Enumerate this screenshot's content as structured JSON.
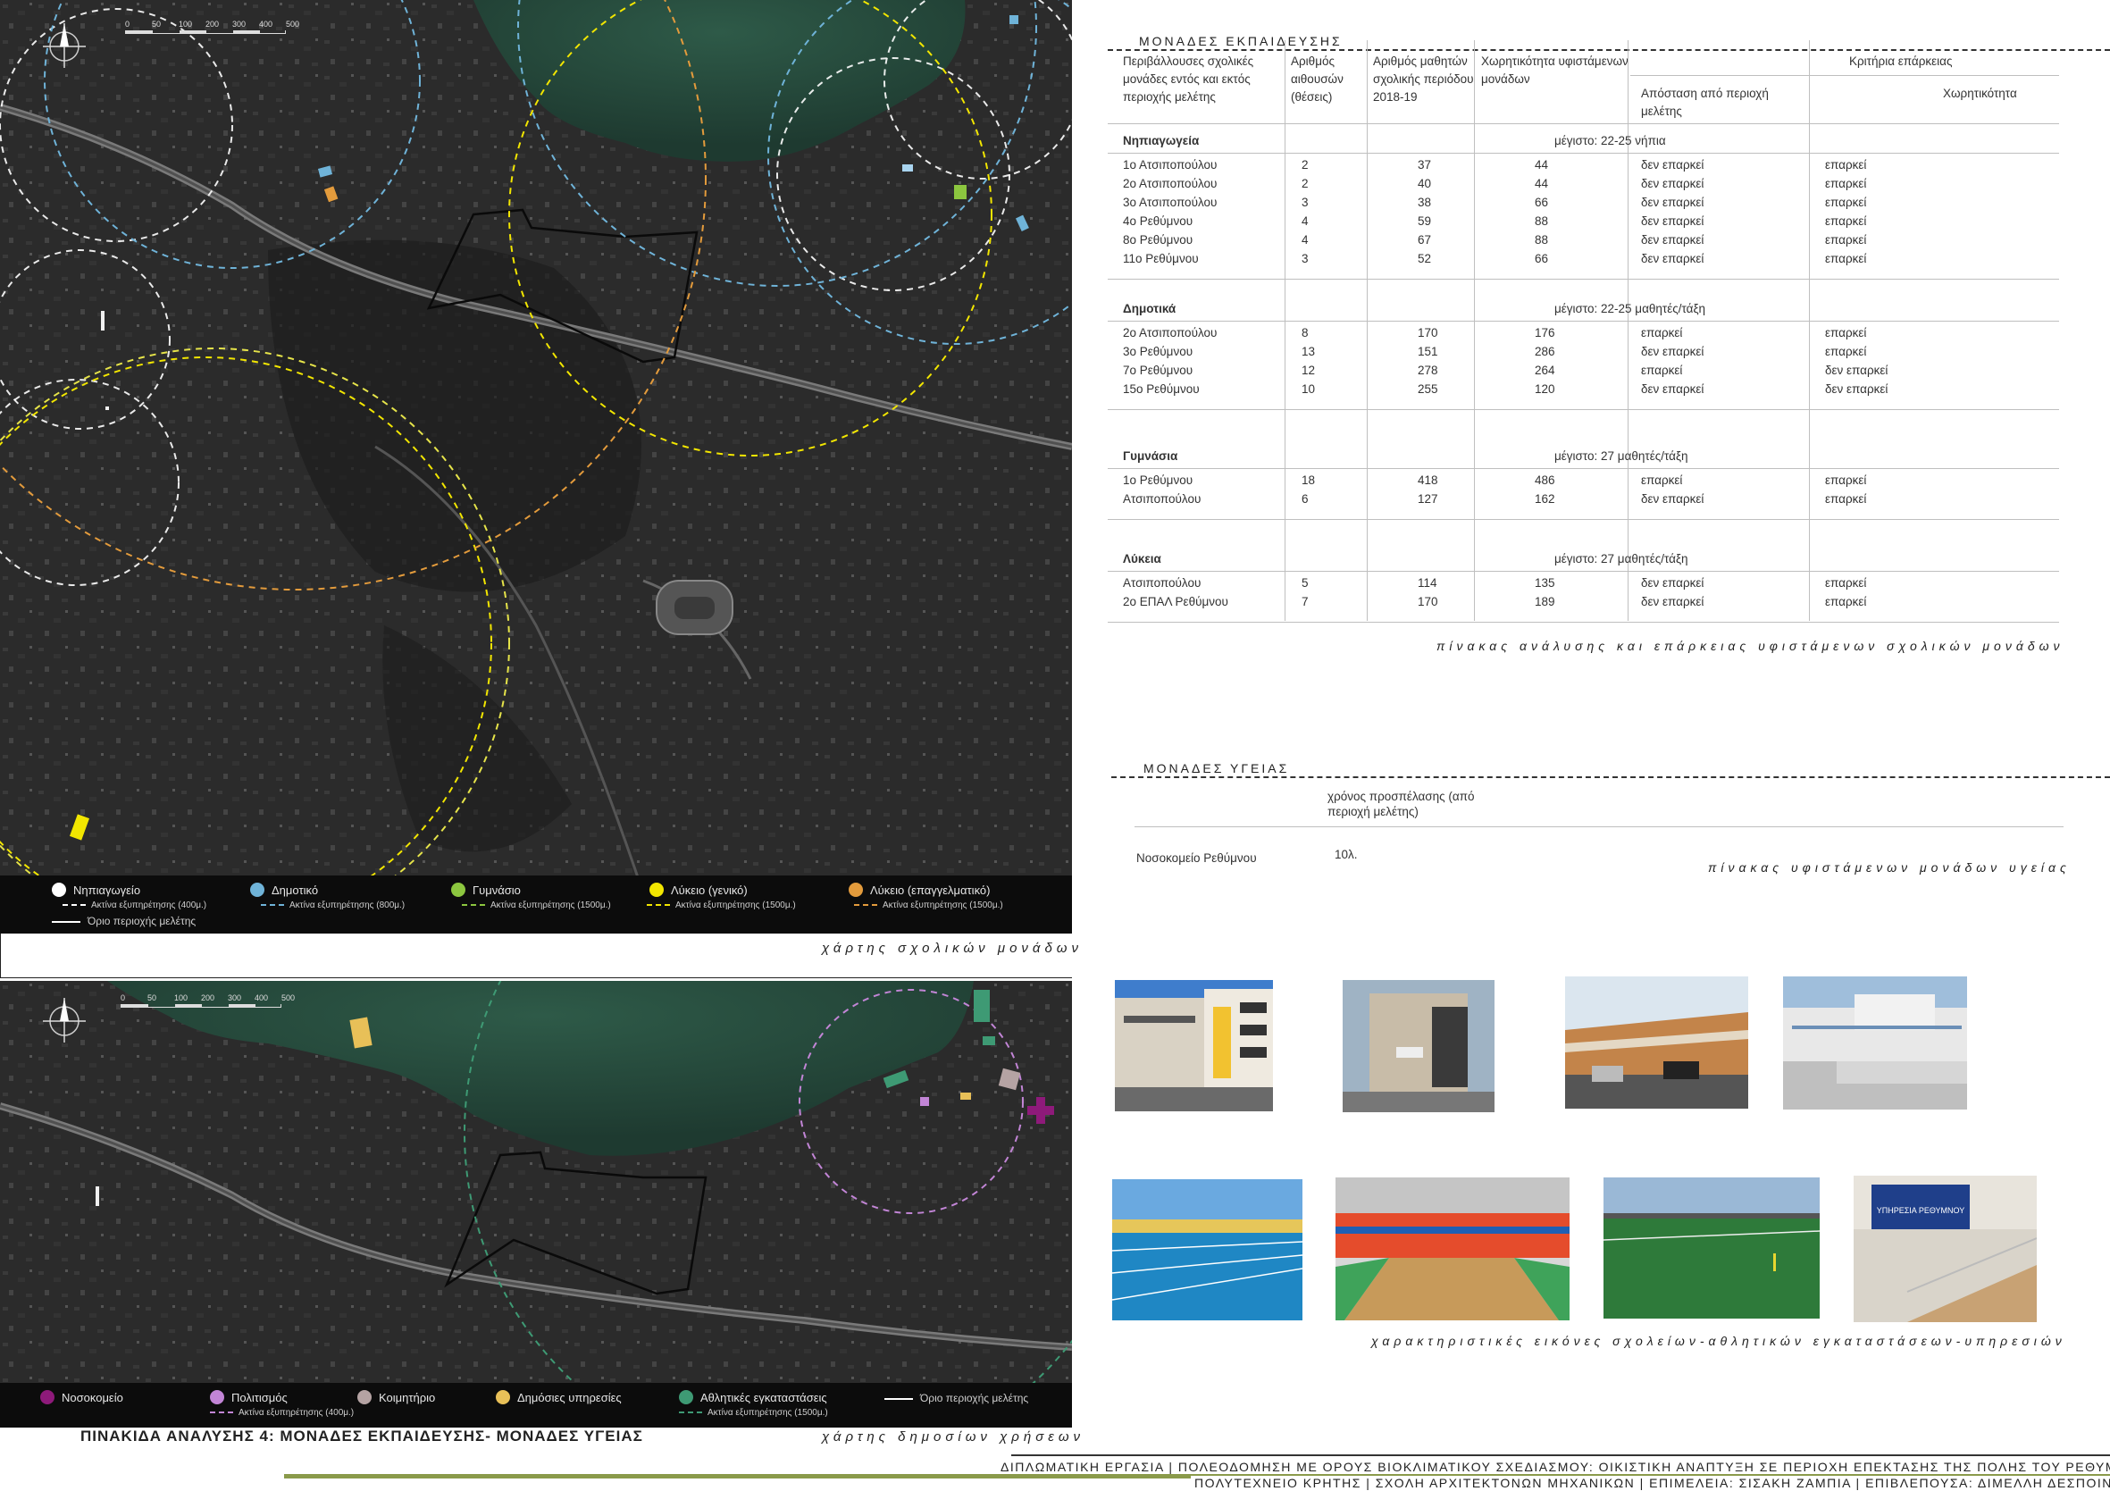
{
  "map1": {
    "scale_ticks": [
      "0",
      "50",
      "100",
      "200",
      "300",
      "400",
      "500"
    ],
    "legend": [
      {
        "label": "Νηπιαγωγείο",
        "color": "#ffffff",
        "radius_label": "Ακτίνα εξυπηρέτησης (400μ.)"
      },
      {
        "label": "Δημοτικό",
        "color": "#6fb3d8",
        "radius_label": "Ακτίνα εξυπηρέτησης (800μ.)"
      },
      {
        "label": "Γυμνάσιο",
        "color": "#8cc63f",
        "radius_label": "Ακτίνα εξυπηρέτησης (1500μ.)"
      },
      {
        "label": "Λύκειο (γενικό)",
        "color": "#f2e600",
        "radius_label": "Ακτίνα εξυπηρέτησης (1500μ.)"
      },
      {
        "label": "Λύκειο (επαγγελματικό)",
        "color": "#e39b3c",
        "radius_label": "Ακτίνα εξυπηρέτησης (1500μ.)"
      }
    ],
    "boundary_label": "Όριο περιοχής μελέτης",
    "caption": "χάρτης σχολικών μονάδων"
  },
  "map2": {
    "scale_ticks": [
      "0",
      "50",
      "100",
      "200",
      "300",
      "400",
      "500"
    ],
    "legend": [
      {
        "label": "Νοσοκομείο",
        "color": "#8e1a7a"
      },
      {
        "label": "Πολιτισμός",
        "color": "#c285d6",
        "radius_label": "Ακτίνα εξυπηρέτησης (400μ.)"
      },
      {
        "label": "Κοιμητήριο",
        "color": "#b5a3a3"
      },
      {
        "label": "Δημόσιες υπηρεσίες",
        "color": "#e8c058"
      },
      {
        "label": "Αθλητικές εγκαταστάσεις",
        "color": "#3e9a74",
        "radius_label": "Ακτίνα εξυπηρέτησης (1500μ.)"
      }
    ],
    "boundary_label": "Όριο περιοχής μελέτης",
    "caption": "χάρτης δημοσίων χρήσεων"
  },
  "edu": {
    "section_title": "ΜΟΝΑΔΕΣ ΕΚΠΑΙΔΕΥΣΗΣ",
    "headers": {
      "school": "Περιβάλλουσες σχολικές μονάδες εντός και εκτός περιοχής μελέτης",
      "rooms": "Αριθμός αιθουσών (θέσεις)",
      "students": "Αριθμός μαθητών σχολικής περιόδου 2018-19",
      "capacity": "Χωρητικότητα υφιστάμενων μονάδων",
      "criteria": "Κριτήρια επάρκειας",
      "distance": "Απόσταση από περιοχή μελέτης",
      "capacity2": "Χωρητικότητα"
    },
    "groups": [
      {
        "title": "Νηπιαγωγεία",
        "max": "μέγιστο: 22-25 νήπια",
        "rows": [
          [
            "1ο Ατσιποπούλου",
            "2",
            "37",
            "44",
            "δεν επαρκεί",
            "επαρκεί"
          ],
          [
            "2ο Ατσιποπούλου",
            "2",
            "40",
            "44",
            "δεν επαρκεί",
            "επαρκεί"
          ],
          [
            "3ο Ατσιποπούλου",
            "3",
            "38",
            "66",
            "δεν επαρκεί",
            "επαρκεί"
          ],
          [
            "4ο Ρεθύμνου",
            "4",
            "59",
            "88",
            "δεν επαρκεί",
            "επαρκεί"
          ],
          [
            "8ο Ρεθύμνου",
            "4",
            "67",
            "88",
            "δεν επαρκεί",
            "επαρκεί"
          ],
          [
            "11ο Ρεθύμνου",
            "3",
            "52",
            "66",
            "δεν επαρκεί",
            "επαρκεί"
          ]
        ]
      },
      {
        "title": "Δημοτικά",
        "max": "μέγιστο: 22-25 μαθητές/τάξη",
        "rows": [
          [
            "2ο Ατσιποπούλου",
            "8",
            "170",
            "176",
            "επαρκεί",
            "επαρκεί"
          ],
          [
            "3ο Ρεθύμνου",
            "13",
            "151",
            "286",
            "δεν επαρκεί",
            "επαρκεί"
          ],
          [
            "7ο Ρεθύμνου",
            "12",
            "278",
            "264",
            "επαρκεί",
            "δεν επαρκεί"
          ],
          [
            "15ο Ρεθύμνου",
            "10",
            "255",
            "120",
            "δεν επαρκεί",
            "δεν επαρκεί"
          ]
        ]
      },
      {
        "title": "Γυμνάσια",
        "max": "μέγιστο: 27 μαθητές/τάξη",
        "rows": [
          [
            "1ο Ρεθύμνου",
            "18",
            "418",
            "486",
            "επαρκεί",
            "επαρκεί"
          ],
          [
            "Ατσιποπούλου",
            "6",
            "127",
            "162",
            "δεν επαρκεί",
            "επαρκεί"
          ]
        ]
      },
      {
        "title": "Λύκεια",
        "max": "μέγιστο: 27 μαθητές/τάξη",
        "rows": [
          [
            "Ατσιποπούλου",
            "5",
            "114",
            "135",
            "δεν επαρκεί",
            "επαρκεί"
          ],
          [
            "2ο ΕΠΑΛ Ρεθύμνου",
            "7",
            "170",
            "189",
            "δεν επαρκεί",
            "επαρκεί"
          ]
        ]
      }
    ],
    "caption": "πίνακας ανάλυσης και επάρκειας υφιστάμενων σχολικών μονάδων"
  },
  "health": {
    "section_title": "ΜΟΝΑΔΕΣ ΥΓΕΙΑΣ",
    "header": "χρόνος προσπέλασης (από περιοχή μελέτης)",
    "row_name": "Νοσοκομείο Ρεθύμνου",
    "row_value": "10λ.",
    "caption": "πίνακας υφιστάμενων μονάδων υγείας"
  },
  "photos_caption": "χαρακτηριστικές εικόνες σχολείων-αθλητικών εγκαταστάσεων-υπηρεσιών",
  "photo_sign_text": "ΥΠΗΡΕΣΙΑ ΡΕΘΥΜΝΟΥ",
  "board_title": "ΠΙΝΑΚΙΔΑ ΑΝΑΛΥΣΗΣ 4: ΜΟΝΑΔΕΣ ΕΚΠΑΙΔΕΥΣΗΣ- ΜΟΝΑΔΕΣ ΥΓΕΙΑΣ",
  "footer": {
    "line1": "ΔΙΠΛΩΜΑΤΙΚΗ ΕΡΓΑΣΙΑ  |  ΠΟΛΕΟΔΟΜΗΣΗ ΜΕ ΟΡΟΥΣ ΒΙΟΚΛΙΜΑΤΙΚΟΥ ΣΧΕΔΙΑΣΜΟΥ: ΟΙΚΙΣΤΙΚΗ ΑΝΑΠΤΥΞΗ ΣΕ ΠΕΡΙΟΧΗ ΕΠΕΚΤΑΣΗΣ ΤΗΣ ΠΟΛΗΣ ΤΟΥ ΡΕΘΥΜΝΟΥ",
    "line2": "ΠΟΛΥΤΕΧΝΕΙΟ ΚΡΗΤΗΣ  |  ΣΧΟΛΗ ΑΡΧΙΤΕΚΤΟΝΩΝ ΜΗΧΑΝΙΚΩΝ  |  ΕΠΙΜΕΛΕΙΑ: ΣΙΣΑΚΗ ΖΑΜΠΙΑ  |  ΕΠΙΒΛΕΠΟΥΣΑ: ΔΙΜΕΛΛΗ ΔΕΣΠΟΙΝΑ",
    "rule_color": "#8a9a4a"
  }
}
